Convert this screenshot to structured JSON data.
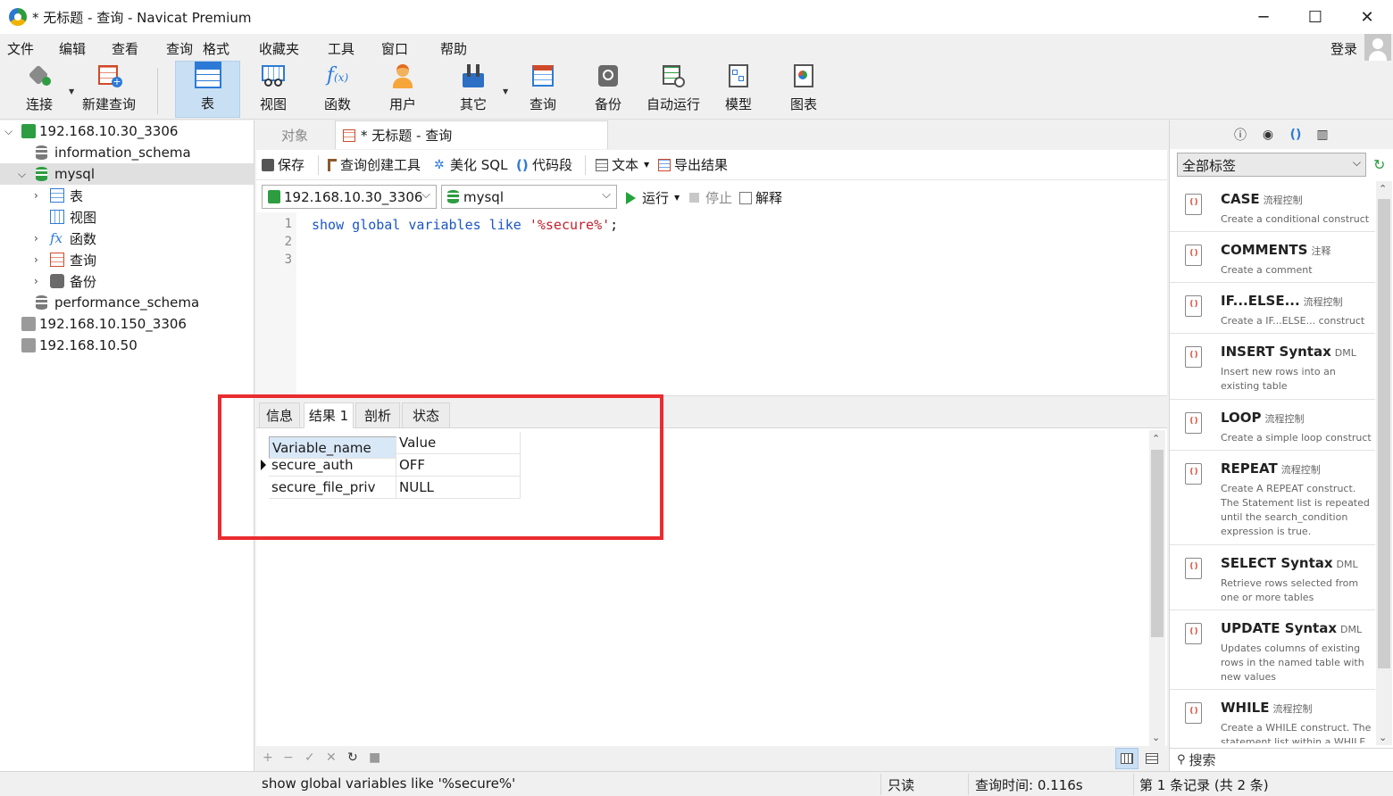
{
  "window": {
    "title": "* 无标题 - 查询 - Navicat Premium",
    "minimize": "─",
    "maximize": "☐",
    "close": "✕"
  },
  "menu": [
    "文件",
    "编辑",
    "查看",
    "查询",
    "格式",
    "收藏夹",
    "工具",
    "窗口",
    "帮助"
  ],
  "login": "登录",
  "toolbar": [
    {
      "label": "连接",
      "icon": "plug-icon"
    },
    {
      "label": "新建查询",
      "icon": "new-query-icon"
    },
    {
      "label": "表",
      "icon": "table-icon"
    },
    {
      "label": "视图",
      "icon": "view-icon"
    },
    {
      "label": "函数",
      "icon": "function-icon"
    },
    {
      "label": "用户",
      "icon": "user-icon"
    },
    {
      "label": "其它",
      "icon": "tools-icon"
    },
    {
      "label": "查询",
      "icon": "query-icon"
    },
    {
      "label": "备份",
      "icon": "backup-icon"
    },
    {
      "label": "自动运行",
      "icon": "auto-run-icon"
    },
    {
      "label": "模型",
      "icon": "model-icon"
    },
    {
      "label": "图表",
      "icon": "chart-icon"
    }
  ],
  "tree": {
    "conn1": "192.168.10.30_3306",
    "db_info": "information_schema",
    "db_mysql": "mysql",
    "node_table": "表",
    "node_view": "视图",
    "node_func": "函数",
    "node_query": "查询",
    "node_backup": "备份",
    "db_perf": "performance_schema",
    "conn2": "192.168.10.150_3306",
    "conn3": "192.168.10.50"
  },
  "tabs": {
    "objects": "对象",
    "query": "* 无标题 - 查询"
  },
  "query_toolbar": {
    "save": "保存",
    "builder": "查询创建工具",
    "beautify": "美化 SQL",
    "snippet": "代码段",
    "text": "文本",
    "export": "导出结果"
  },
  "selectors": {
    "connection": "192.168.10.30_3306",
    "database": "mysql",
    "run": "运行",
    "stop": "停止",
    "explain": "解释"
  },
  "editor": {
    "lines": [
      "1",
      "2",
      "3"
    ],
    "sql_kw": "show global variables like ",
    "sql_str": "'%secure%'",
    "sql_end": ";"
  },
  "result_tabs": [
    "信息",
    "结果 1",
    "剖析",
    "状态"
  ],
  "grid": {
    "headers": [
      "Variable_name",
      "Value"
    ],
    "rows": [
      [
        "secure_auth",
        "OFF"
      ],
      [
        "secure_file_priv",
        "NULL"
      ]
    ]
  },
  "status": {
    "sql": "show global variables like '%secure%'",
    "readonly": "只读",
    "time": "查询时间: 0.116s",
    "records": "第 1 条记录 (共 2 条)"
  },
  "right_panel": {
    "tag_select": "全部标签",
    "search": "搜索",
    "snippets": [
      {
        "title": "CASE",
        "tag": "流程控制",
        "desc": "Create a conditional construct"
      },
      {
        "title": "COMMENTS",
        "tag": "注释",
        "desc": "Create a comment"
      },
      {
        "title": "IF...ELSE...",
        "tag": "流程控制",
        "desc": "Create a IF...ELSE... construct"
      },
      {
        "title": "INSERT Syntax",
        "tag": "DML",
        "desc": "Insert new rows into an existing table"
      },
      {
        "title": "LOOP",
        "tag": "流程控制",
        "desc": "Create a simple loop construct"
      },
      {
        "title": "REPEAT",
        "tag": "流程控制",
        "desc": "Create A REPEAT construct. The Statement list is repeated until the search_condition expression is true."
      },
      {
        "title": "SELECT Syntax",
        "tag": "DML",
        "desc": "Retrieve rows selected from one or more tables"
      },
      {
        "title": "UPDATE Syntax",
        "tag": "DML",
        "desc": "Updates columns of existing rows in the named table with new values"
      },
      {
        "title": "WHILE",
        "tag": "流程控制",
        "desc": "Create a WHILE construct. The statement list within a WHILE"
      }
    ]
  }
}
